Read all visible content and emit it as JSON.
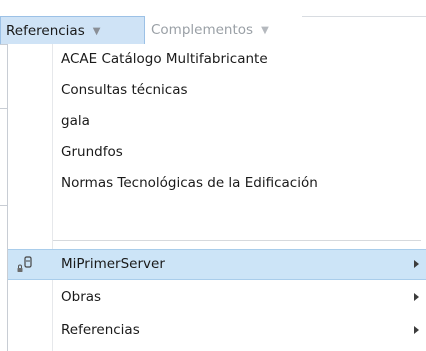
{
  "menubar": {
    "active_tab": "Referencias",
    "inactive_tab": "Complementos",
    "caret": "▼"
  },
  "dropdown": {
    "items": [
      {
        "label": "ACAE Catálogo Multifabricante",
        "has_submenu": false
      },
      {
        "label": "Consultas técnicas",
        "has_submenu": false
      },
      {
        "label": "gala",
        "has_submenu": false
      },
      {
        "label": "Grundfos",
        "has_submenu": false
      },
      {
        "label": "Normas Tecnológicas de la Edificación",
        "has_submenu": false
      },
      {
        "label": "MiPrimerServer",
        "has_submenu": true,
        "highlighted": true,
        "icon": "server-lock-icon"
      },
      {
        "label": "Obras",
        "has_submenu": true
      },
      {
        "label": "Referencias",
        "has_submenu": true
      }
    ]
  },
  "colors": {
    "highlight": "#cce4f7",
    "active_tab": "#cfe3f6",
    "inactive_text": "#9aa0a6"
  }
}
